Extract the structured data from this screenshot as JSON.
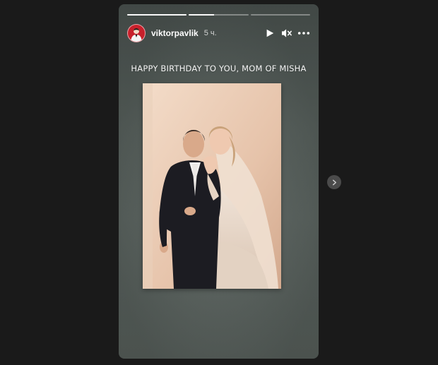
{
  "story": {
    "progress": [
      1.0,
      0.42,
      0.0
    ],
    "username": "viktorpavlik",
    "time_ago": "5 ч.",
    "caption": "HAPPY BIRTHDAY TO YOU, MOM OF MISHA",
    "controls": {
      "play_icon": "play-icon",
      "mute_icon": "speaker-muted-icon",
      "more_icon": "more-options-icon"
    },
    "avatar_color": "#c8202b"
  },
  "navigation": {
    "next_icon": "chevron-right-icon"
  }
}
